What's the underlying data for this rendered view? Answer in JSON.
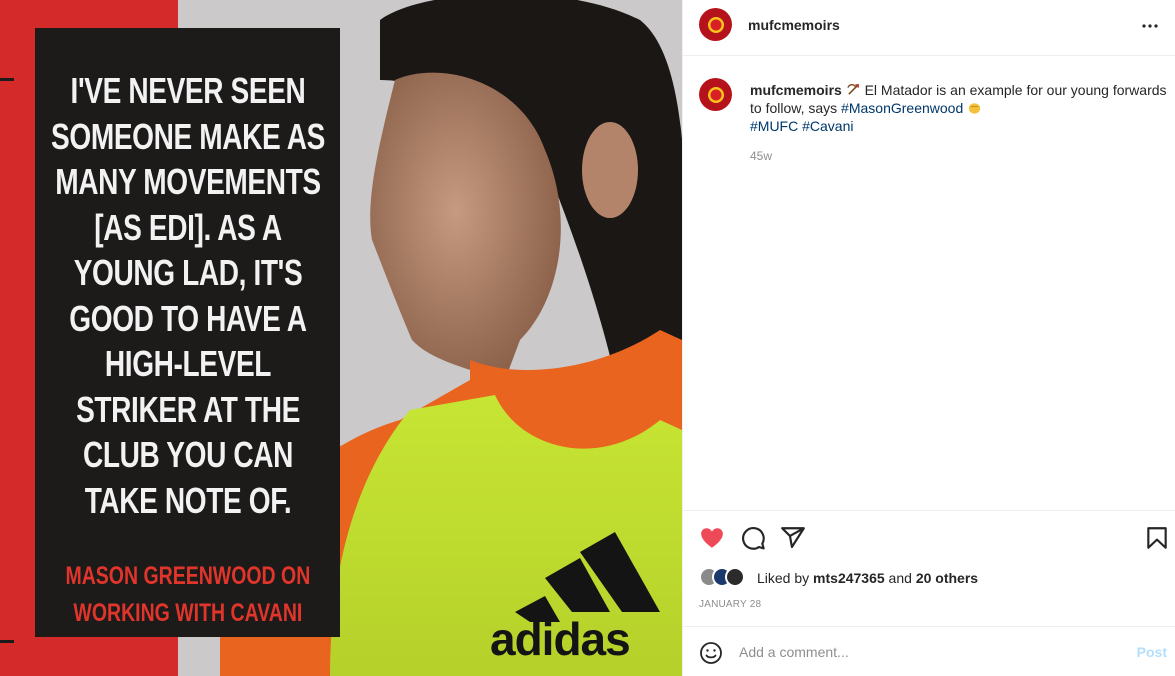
{
  "post": {
    "username": "mufcmemoirs",
    "more_icon": "more-horizontal-icon",
    "image": {
      "quote": "I'VE NEVER SEEN SOMEONE MAKE AS MANY MOVEMENTS [AS EDI]. AS A YOUNG LAD, IT'S GOOD TO HAVE A HIGH-LEVEL STRIKER AT THE CLUB YOU CAN TAKE NOTE OF.",
      "attribution": "MASON GREENWOOD ON WORKING WITH CAVANI",
      "brand": "adidas"
    },
    "caption": {
      "username": "mufcmemoirs",
      "text_before": " El Matador is an example for our young forwards to follow, says ",
      "hashtag1": "#MasonGreenwood",
      "hashtag2": "#MUFC",
      "hashtag3": "#Cavani",
      "emoji1": "bow-and-arrow-emoji",
      "emoji2": "fist-emoji",
      "age": "45w"
    },
    "likes": {
      "prefix": "Liked by ",
      "user": "mts247365",
      "middle": " and ",
      "others": "20 others"
    },
    "date": "JANUARY 28",
    "comment": {
      "placeholder": "Add a comment...",
      "post_label": "Post"
    },
    "colors": {
      "like_red": "#ed4956",
      "hashtag_blue": "#00376b",
      "post_disabled": "#b2dffc",
      "brand_red": "#b6121b"
    }
  }
}
